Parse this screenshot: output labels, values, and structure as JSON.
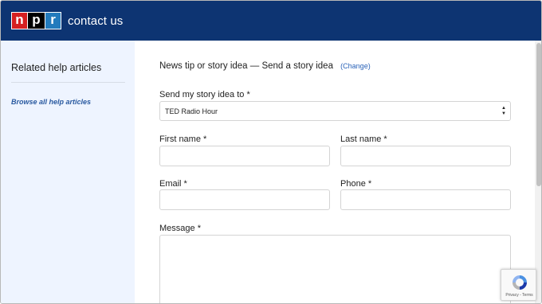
{
  "header": {
    "logo_letters": [
      "n",
      "p",
      "r"
    ],
    "title": "contact us"
  },
  "sidebar": {
    "heading": "Related help articles",
    "link": "Browse all help articles"
  },
  "form": {
    "topic": "News tip or story idea — Send a story idea",
    "change_link": "(Change)",
    "send_to_label": "Send my story idea to *",
    "send_to_value": "TED Radio Hour",
    "first_name_label": "First name *",
    "last_name_label": "Last name *",
    "email_label": "Email *",
    "phone_label": "Phone *",
    "message_label": "Message *"
  },
  "recaptcha": {
    "terms": "Privacy - Terms"
  },
  "colors": {
    "header_bg": "#0d3472",
    "sidebar_bg": "#eef4ff",
    "link": "#2a5aa0",
    "logo_n": "#d62021",
    "logo_p": "#000000",
    "logo_r": "#237bbd"
  }
}
